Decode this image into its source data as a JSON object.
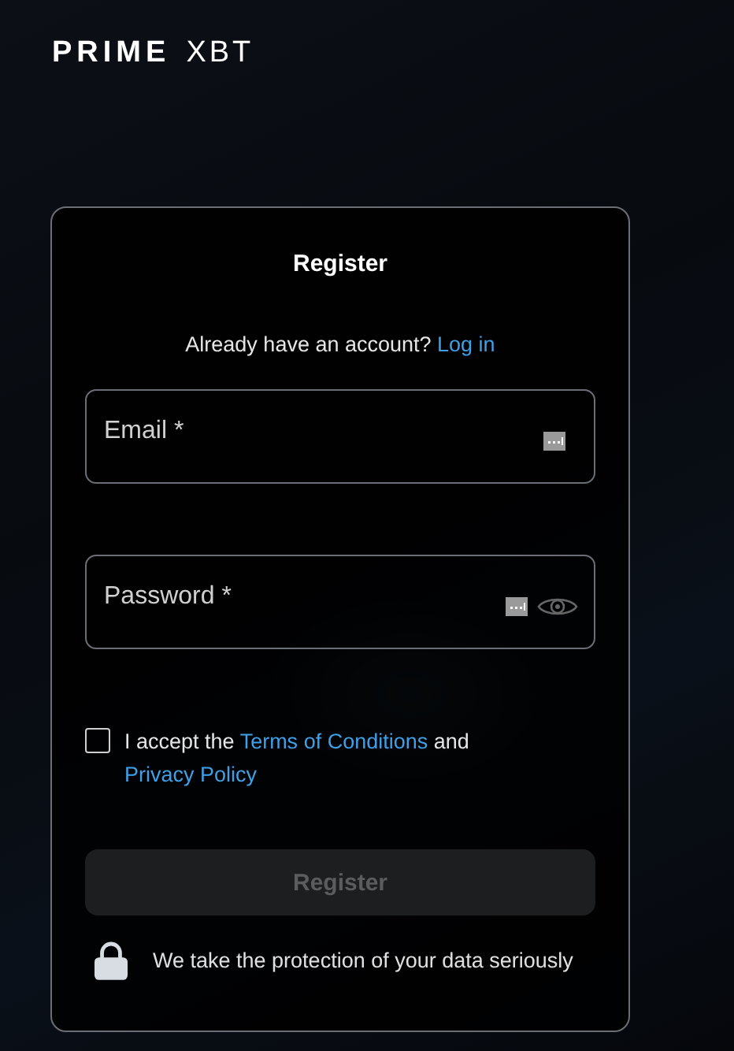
{
  "logo": {
    "brand": "PRIME",
    "suffix": "XBT"
  },
  "form": {
    "title": "Register",
    "login_prompt": {
      "text": "Already have an account?",
      "link": "Log in"
    },
    "fields": [
      {
        "kind": "email",
        "placeholder": "Email *"
      },
      {
        "kind": "password",
        "placeholder": "Password *"
      }
    ],
    "terms": {
      "checked": false,
      "parts": [
        {
          "text": "I accept the ",
          "link": false
        },
        {
          "text": "Terms of Conditions",
          "link": true
        },
        {
          "text": " and ",
          "link": false
        },
        {
          "text": "Privacy Policy",
          "link": true
        }
      ]
    },
    "submit": {
      "label": "Register",
      "disabled": true
    },
    "security_note": "We take the protection of your data seriously"
  }
}
